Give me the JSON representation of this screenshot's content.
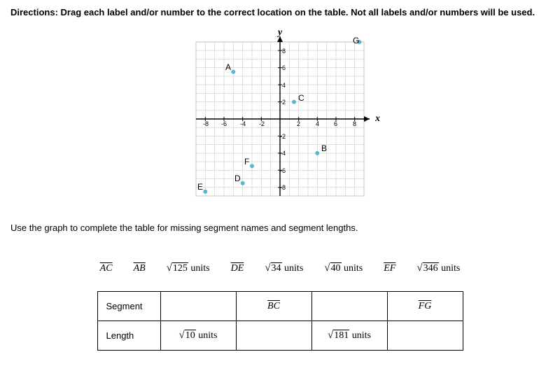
{
  "directions": "Directions: Drag each label and/or number to the correct location on the table. Not all labels and/or numbers will be used.",
  "instruction": "Use the graph to complete the table for missing segment names and segment lengths.",
  "axes": {
    "x": "x",
    "y": "y"
  },
  "ticks": [
    "-8",
    "-6",
    "-4",
    "-2",
    "2",
    "4",
    "6",
    "8"
  ],
  "points": {
    "A": {
      "x": -5,
      "y": 5.5,
      "label": "A"
    },
    "B": {
      "x": 4,
      "y": -4,
      "label": "B"
    },
    "C": {
      "x": 1.5,
      "y": 2,
      "label": "C"
    },
    "D": {
      "x": -4,
      "y": -7.5,
      "label": "D"
    },
    "E": {
      "x": -8,
      "y": -8.5,
      "label": "E"
    },
    "F": {
      "x": -3,
      "y": -5.5,
      "label": "F"
    },
    "G": {
      "x": 8.5,
      "y": 9,
      "label": "G"
    }
  },
  "pool": {
    "l1": "AC",
    "l2": "AB",
    "l3_root": "125",
    "l3_unit": " units",
    "l4": "DE",
    "l5_root": "34",
    "l5_unit": " units",
    "l6_root": "40",
    "l6_unit": " units",
    "l7": "EF",
    "l8_root": "346",
    "l8_unit": " units"
  },
  "table": {
    "row1hdr": "Segment",
    "row2hdr": "Length",
    "c1_seg": "",
    "c1_len_root": "10",
    "c1_len_unit": " units",
    "c2_seg": "BC",
    "c2_len": "",
    "c3_seg": "",
    "c3_len_root": "181",
    "c3_len_unit": " units",
    "c4_seg": "FG",
    "c4_len": ""
  },
  "chart_data": {
    "type": "scatter",
    "title": "",
    "xlabel": "x",
    "ylabel": "y",
    "xlim": [
      -9,
      9
    ],
    "ylim": [
      -9,
      9
    ],
    "series": [
      {
        "name": "A",
        "x": -5,
        "y": 5.5,
        "label": "A"
      },
      {
        "name": "B",
        "x": 4,
        "y": -4,
        "label": "B"
      },
      {
        "name": "C",
        "x": 1.5,
        "y": 2,
        "label": "C"
      },
      {
        "name": "D",
        "x": -4,
        "y": -7.5,
        "label": "D"
      },
      {
        "name": "E",
        "x": -8,
        "y": -8.5,
        "label": "E"
      },
      {
        "name": "F",
        "x": -3,
        "y": -5.5,
        "label": "F"
      },
      {
        "name": "G",
        "x": 8.5,
        "y": 9,
        "label": "G"
      }
    ]
  }
}
